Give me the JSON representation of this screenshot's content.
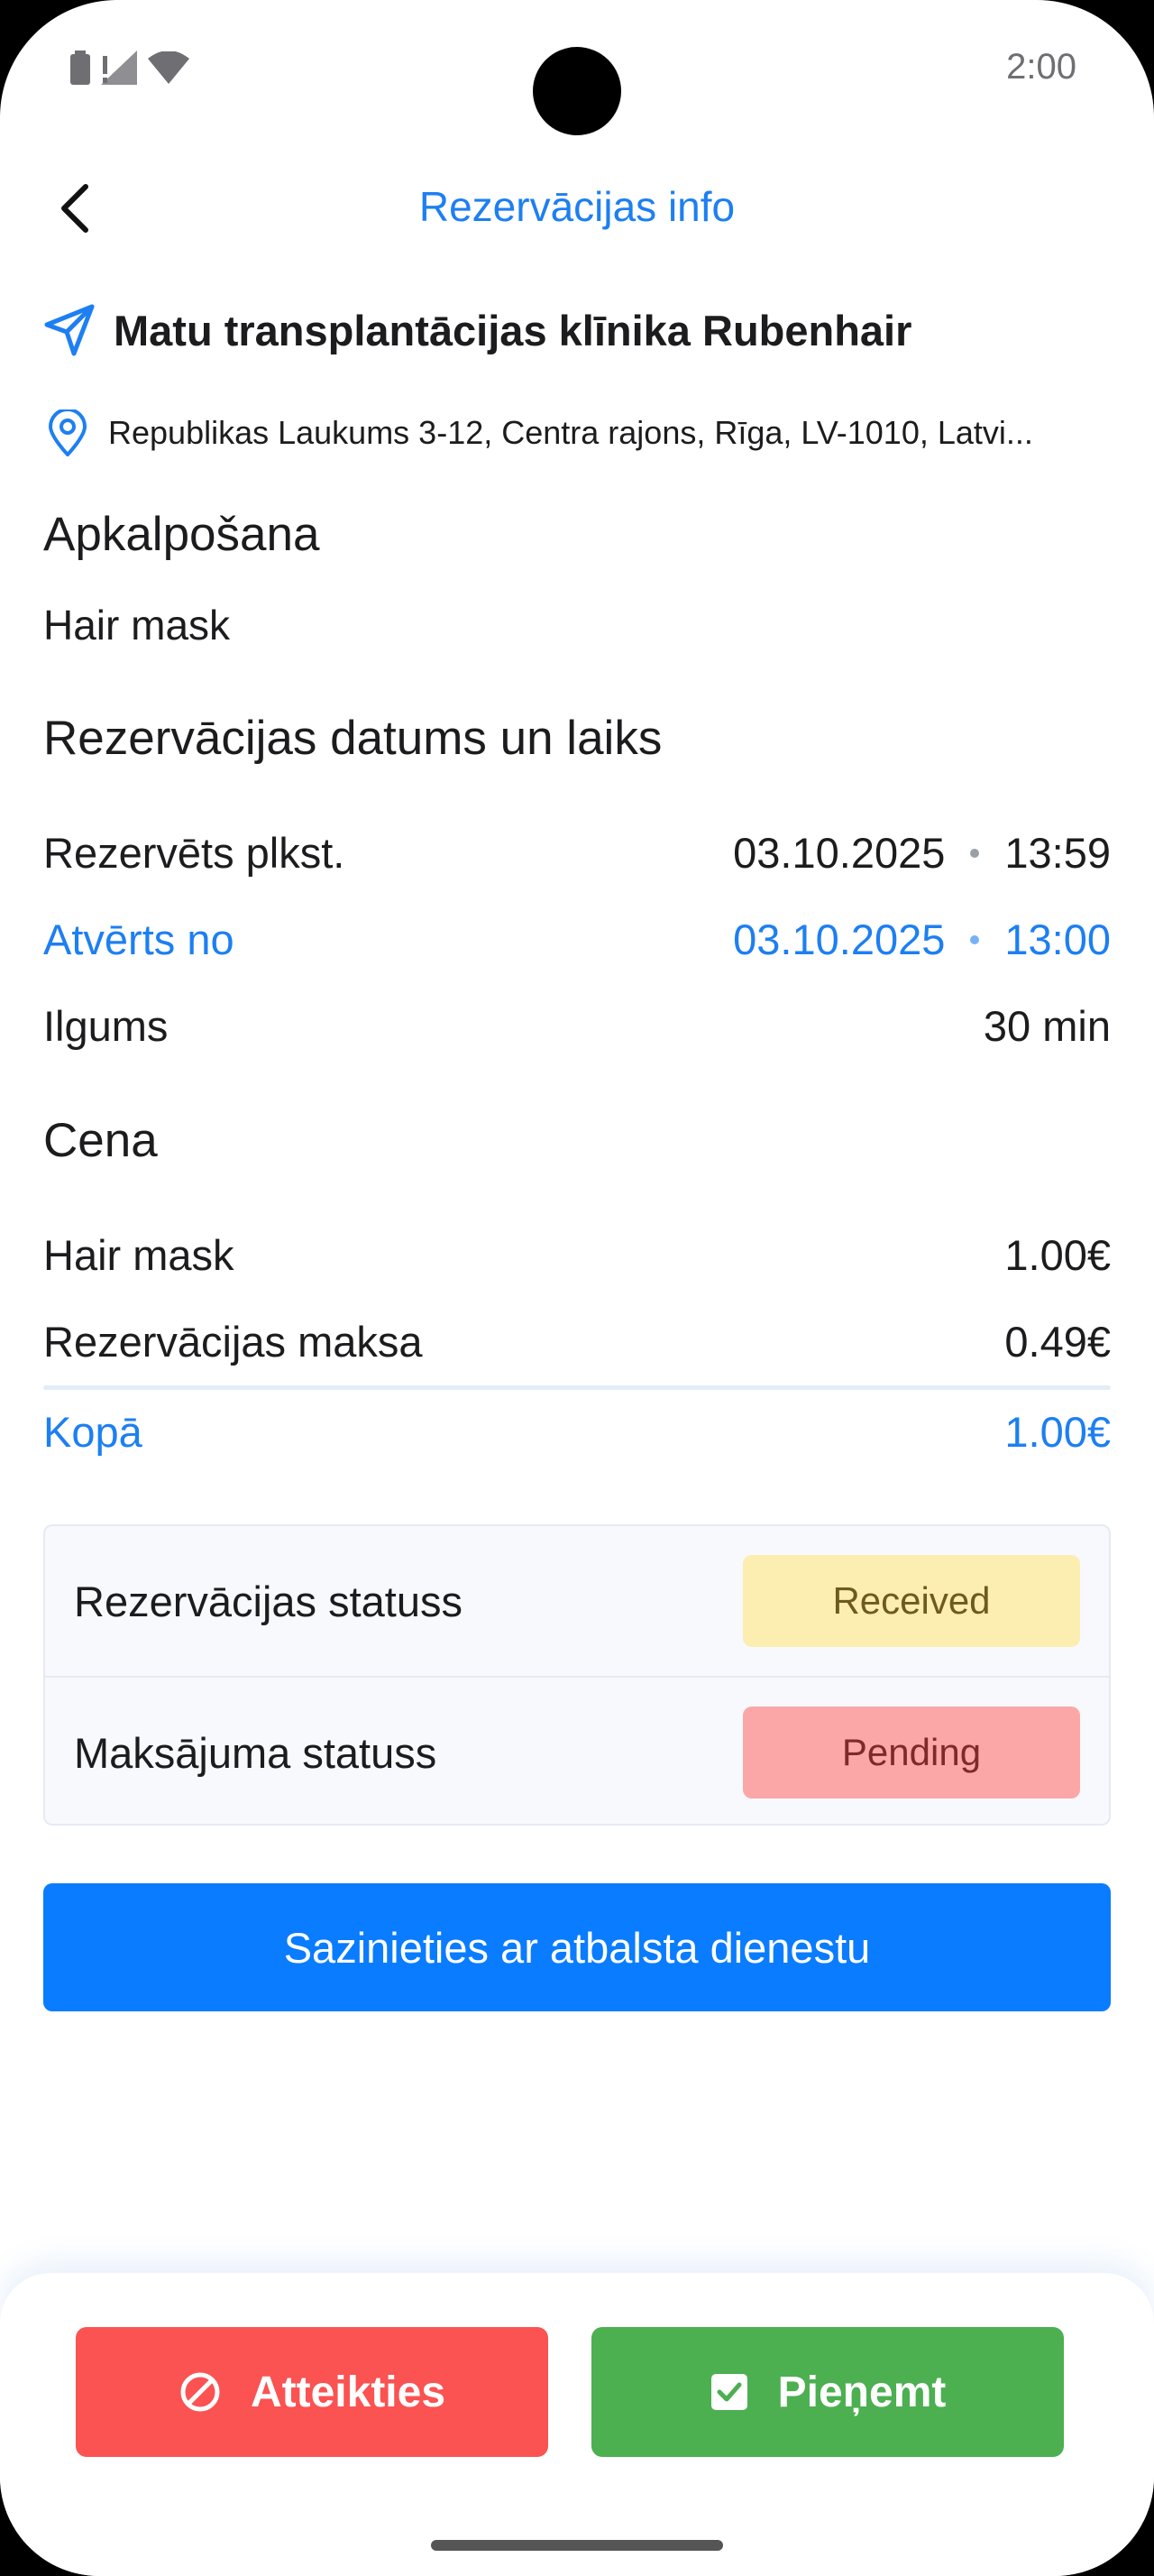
{
  "status_bar": {
    "time": "2:00"
  },
  "header": {
    "title": "Rezervācijas info",
    "back_icon": "chevron-left-icon"
  },
  "clinic": {
    "name": "Matu transplantācijas klīnika Rubenhair",
    "address": "Republikas Laukums 3-12, Centra rajons, Rīga, LV-1010, Latvi..."
  },
  "service": {
    "title": "Apkalpošana",
    "name": "Hair mask"
  },
  "schedule": {
    "title": "Rezervācijas datums un laiks",
    "booked_label": "Rezervēts plkst.",
    "booked_date": "03.10.2025",
    "booked_time": "13:59",
    "opened_label": "Atvērts no",
    "opened_date": "03.10.2025",
    "opened_time": "13:00",
    "duration_label": "Ilgums",
    "duration_value": "30 min"
  },
  "price": {
    "title": "Cena",
    "service_label": "Hair mask",
    "service_value": "1.00€",
    "fee_label": "Rezervācijas maksa",
    "fee_value": "0.49€",
    "total_label": "Kopā",
    "total_value": "1.00€"
  },
  "status": {
    "booking_label": "Rezervācijas statuss",
    "booking_value": "Received",
    "payment_label": "Maksājuma statuss",
    "payment_value": "Pending"
  },
  "support_button": "Sazinieties ar atbalsta dienestu",
  "actions": {
    "decline": "Atteikties",
    "accept": "Pieņemt"
  },
  "colors": {
    "accent": "#1d7ff2",
    "primary_button": "#0a7cff",
    "decline": "#fb5252",
    "accept": "#4caf50",
    "received_badge": "#fcedb1",
    "pending_badge": "#fca7a7"
  }
}
